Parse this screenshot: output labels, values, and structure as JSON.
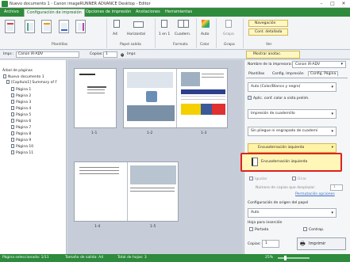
{
  "window": {
    "title": "Nuevo documento 1 - Canon imageRUNNER ADVANCE Desktop - Editor",
    "buttons": [
      "–",
      "□",
      "✕"
    ]
  },
  "ribbon_tabs": [
    "Archivo",
    "Configuración de impresión",
    "Opciones de impresión",
    "Anotaciones",
    "Herramientas"
  ],
  "ribbon": {
    "plantillas_label": "Plantillas",
    "papel_salida_label": "Papel salida",
    "formato_label": "Formato",
    "color_label": "Color",
    "grapa_label": "Grapa",
    "ver_label": "Ver",
    "size_value": "A4",
    "orientation_value": "Horizontal",
    "nup_value": "1 en 1",
    "layout_value": "Cuadern.",
    "color_value": "Auto",
    "grapa_value": "Grapa",
    "navegacion": "Navegación",
    "cont_detallada": "Cont. detallada"
  },
  "toolbar": {
    "impr_label": "Impr.:",
    "printer": "Canon iR-ADV",
    "copias_label": "Copias:",
    "copias_value": "1",
    "impr_btn": "Impr.",
    "mostrar_btn": "Mostrar anotac."
  },
  "tree": {
    "header": "Árbol de páginas",
    "root": "Nuevo documento 1",
    "chapter": "[Capítulo1] Summary of F",
    "pages": [
      "Página 1",
      "Página 2",
      "Página 3",
      "Página 4",
      "Página 5",
      "Página 6",
      "Página 7",
      "Página 8",
      "Página 9",
      "Página 10",
      "Página 11"
    ]
  },
  "canvas": {
    "labels": [
      "1-1",
      "1-2",
      "1-3",
      "1-4",
      "1-5"
    ]
  },
  "right_panel": {
    "printer_label": "Nombre de la impresora:",
    "printer_value": "Canon iR-ADV",
    "tabs": [
      "Plantillas",
      "Config. Impresión",
      "Config. Página"
    ],
    "color_mode": "Auto (Color/Blanco y negro)",
    "aplic_conf": "Aplic. conf. color a vista prelim.",
    "impresion_cuadernillo": "Impresión de cuadernillo",
    "sin_pliegue": "Sin pliegue ni engrapado de cuaderni",
    "encuadernacion": "Encuadernación izquierda",
    "encuadernacion_option": "Encuadernación izquierda",
    "igualar": "Igualar",
    "girar": "Girar",
    "num_copias": "Número de copias que desplazar:",
    "num_copias_value": "1",
    "permutacion": "Permutación opciones",
    "config_origen": "Configuración de origen del papel",
    "origen_value": "Auto",
    "hoja_insercion": "Hoja para inserción",
    "portada": "Portada",
    "contrap": "Contrap.",
    "copias_label": "Copias:",
    "copias_value": "1",
    "imprimir": "Imprimir"
  },
  "status": {
    "pagina_sel": "Página seleccionada: 1/11",
    "tamano": "Tamaño de salida: A4",
    "total_hojas": "Total de hojas: 3",
    "zoom": "25%"
  },
  "colors": {
    "accent": "#2e8a3c",
    "highlight": "#fff3a8",
    "callout": "#e02020"
  }
}
